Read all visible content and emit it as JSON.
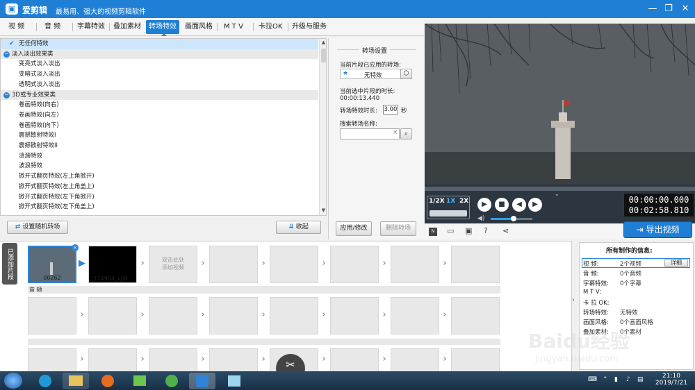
{
  "app": {
    "title": "爱剪辑",
    "slogan": "最易用、强大的视频剪辑软件",
    "icon": "film-icon"
  },
  "window_controls": {
    "minimize": "—",
    "restore": "❐",
    "close": "✕"
  },
  "tabs": [
    {
      "label": "视 频"
    },
    {
      "label": "音 频"
    },
    {
      "label": "字幕特效"
    },
    {
      "label": "叠加素材"
    },
    {
      "label": "转场特效",
      "active": true
    },
    {
      "label": "画面风格"
    },
    {
      "label": "M T V"
    },
    {
      "label": "卡拉OK"
    },
    {
      "label": "升级与服务"
    }
  ],
  "effects": {
    "selected": "无任何特效",
    "categories": [
      {
        "name": "淡入淡出效果类",
        "items": [
          "变亮式淡入淡出",
          "变暗式淡入淡出",
          "透明式淡入淡出"
        ]
      },
      {
        "name": "3D或专业效果类",
        "items": [
          "卷画特效(向右)",
          "卷画特效(向左)",
          "卷画特效(向下)",
          "震撼散射特效I",
          "震撼散射特效II",
          "涟漪特效",
          "波浪特效",
          "掀开式翻页特效(左上角掀开)",
          "掀开式翻页特效(左上角盖上)",
          "掀开式翻页特效(左下角掀开)",
          "掀开式翻页特效(左下角盖上)"
        ]
      }
    ]
  },
  "bottom_buttons": {
    "random": "设置随机转场",
    "collapse": "收起"
  },
  "settings": {
    "heading": "转场设置",
    "applied_label": "当前片段已应用的转场:",
    "applied_value": "无特效",
    "duration_label": "当前选中片段的时长:",
    "duration_value": "00:00:13.440",
    "effect_duration_label": "转场特效时长:",
    "effect_duration_value": "3.00",
    "effect_duration_unit": "秒",
    "search_label": "搜索转场名称:",
    "search_value": "",
    "apply_button": "应用/修改",
    "delete_button": "删除转场"
  },
  "player": {
    "speeds": [
      "1/2X",
      "1X",
      "2X"
    ],
    "active_speed": "1X",
    "current_time": "00:00:00.000",
    "total_time": "00:02:58.810",
    "volume": 0.55,
    "export_button": "导出视频"
  },
  "timeline": {
    "tab_label": "已添加片段",
    "clips": [
      {
        "name": "00262"
      },
      {
        "name": "114904_vj师..."
      }
    ],
    "add_placeholder": "双击此处\n添加视频",
    "audio_label": "音 频"
  },
  "info": {
    "title": "所有制作的信息:",
    "detail_button": "详细",
    "rows": [
      {
        "key": "视    频:",
        "value": "2个视频"
      },
      {
        "key": "音    频:",
        "value": "0个音频"
      },
      {
        "key": "字幕特效:",
        "value": "0个字幕"
      },
      {
        "key": "M  T  V:",
        "value": ""
      },
      {
        "key": "卡 拉 OK:",
        "value": ""
      },
      {
        "key": "转场特效:",
        "value": "无特效"
      },
      {
        "key": "画面风格:",
        "value": "0个画面风格"
      },
      {
        "key": "叠加素材:",
        "value": "0个素材"
      }
    ]
  },
  "taskbar": {
    "time": "21:10",
    "date": "2019/7/21"
  },
  "watermark": {
    "text": "Baidu经验",
    "sub": "jingyan.baidu.com"
  }
}
